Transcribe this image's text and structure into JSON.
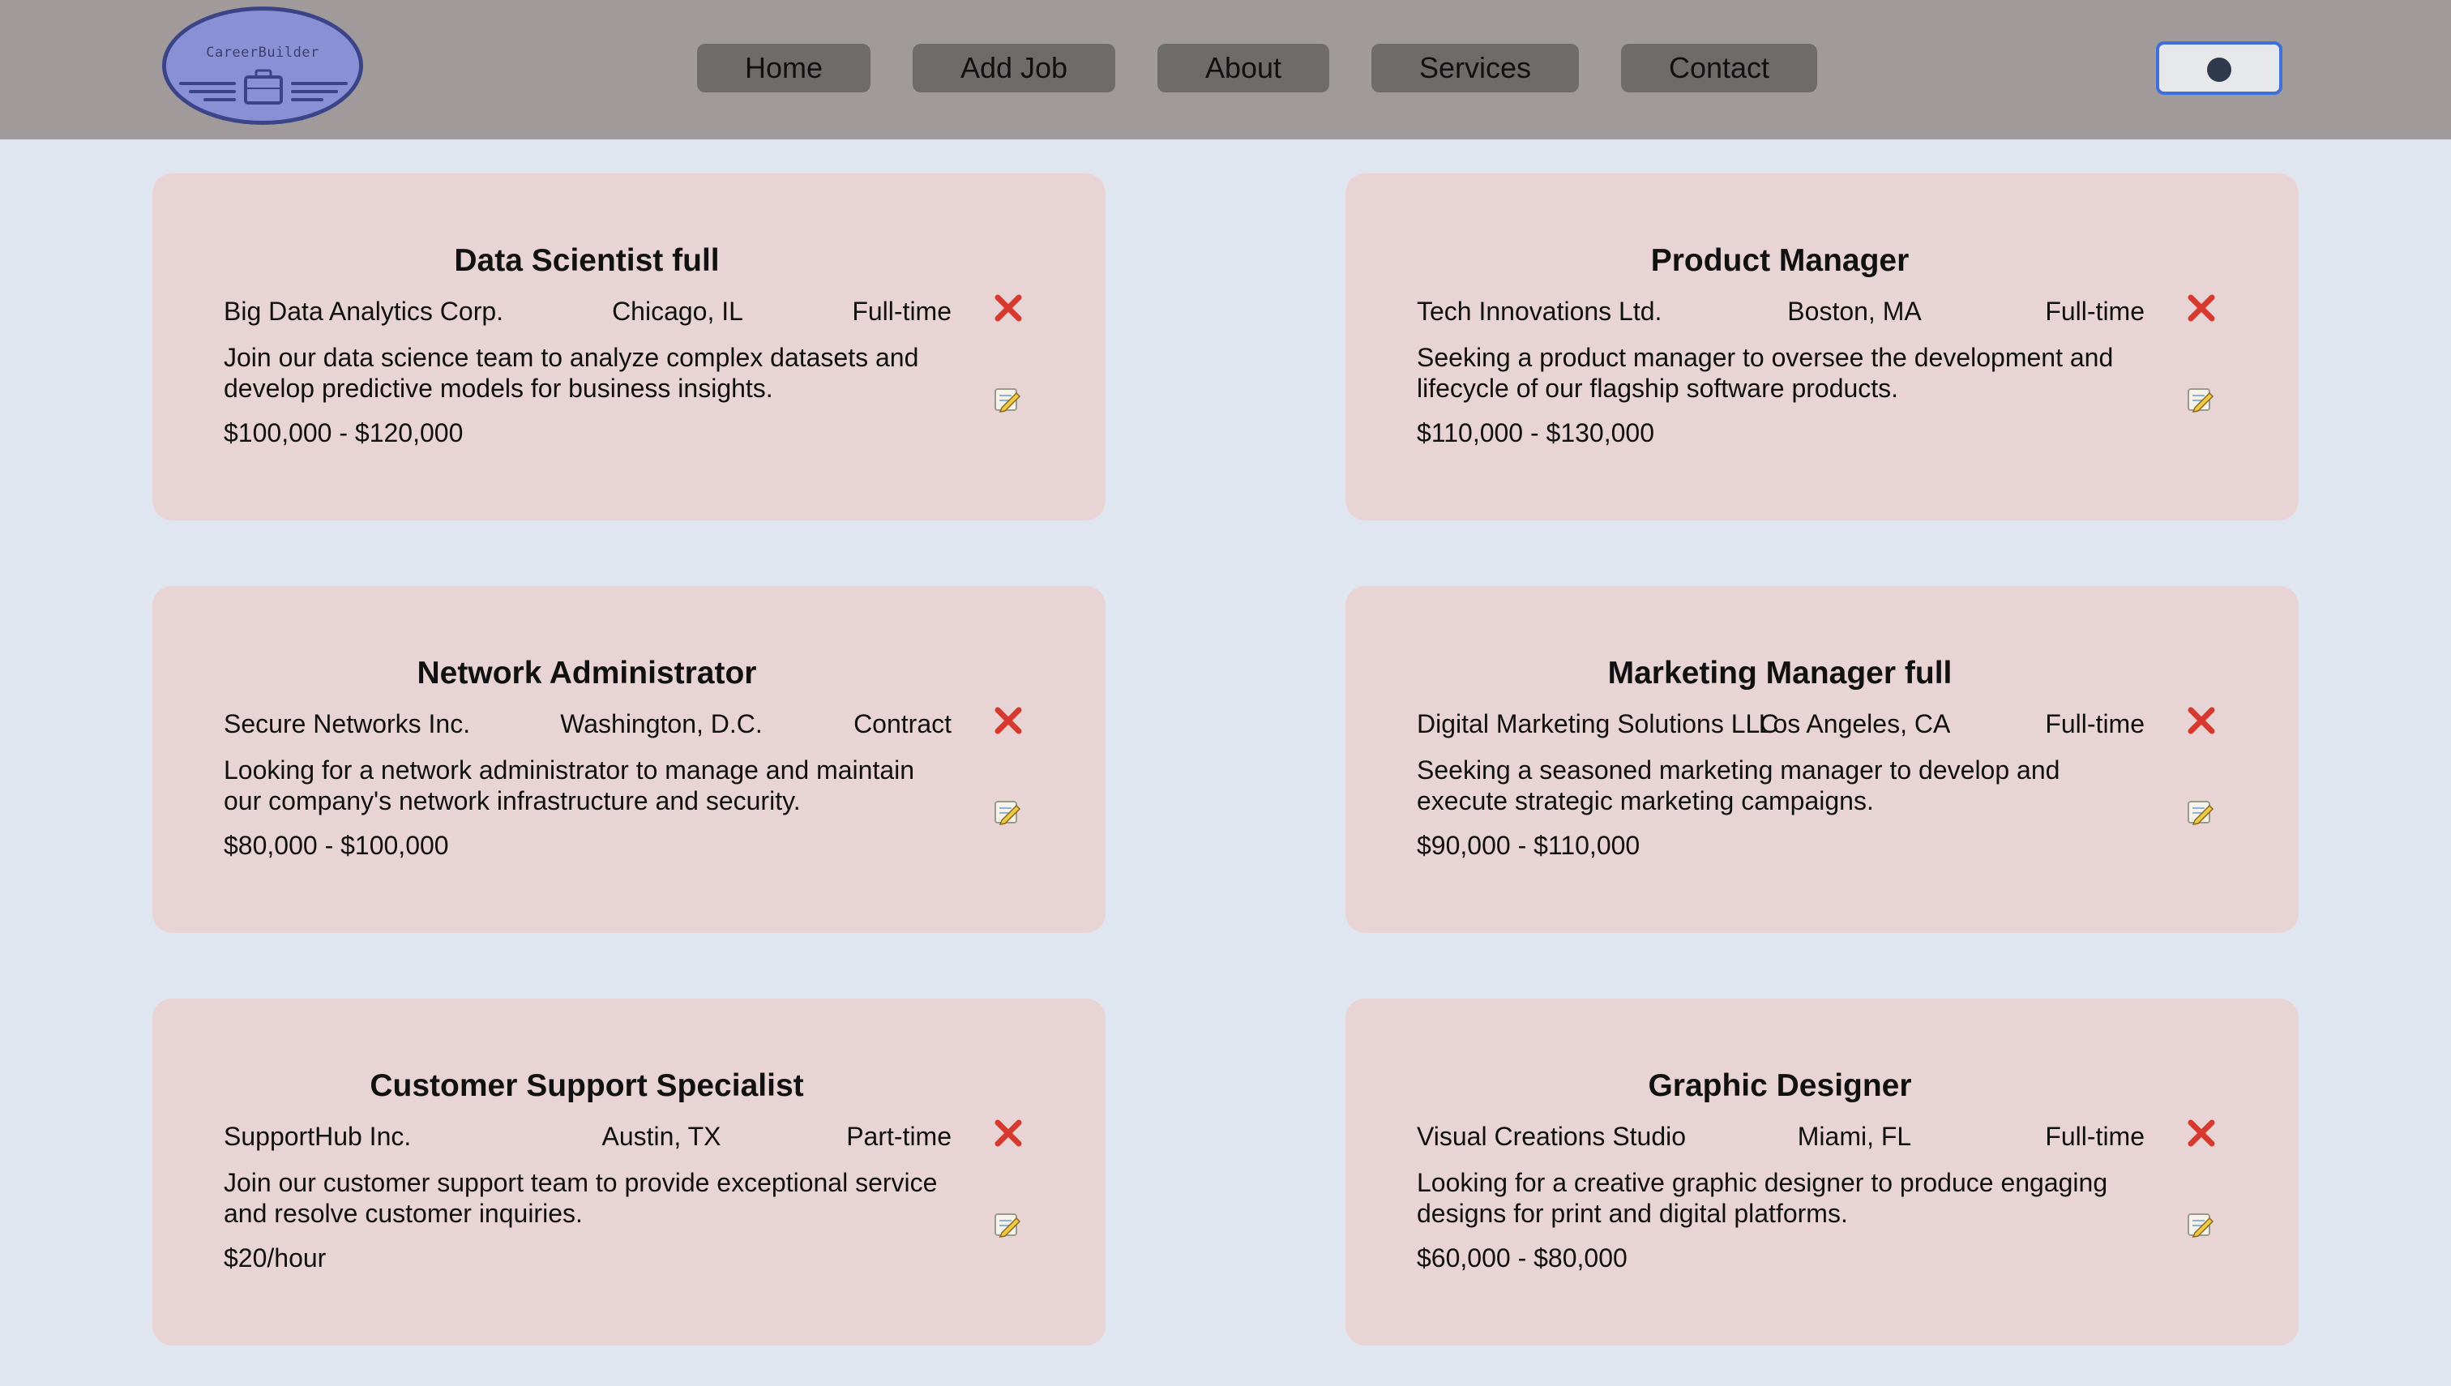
{
  "logo": {
    "text": "CareerBuilder",
    "icon": "briefcase-icon"
  },
  "nav": {
    "links": [
      {
        "label": "Home"
      },
      {
        "label": "Add Job"
      },
      {
        "label": "About"
      },
      {
        "label": "Services"
      },
      {
        "label": "Contact"
      }
    ]
  },
  "theme_toggle": {
    "icon": "theme-toggle-knob"
  },
  "colors": {
    "navbar": "#a09a9a",
    "page_background": "#e0e6f0",
    "card_background": "#e8d4d4",
    "nav_button": "#6e6b6b",
    "delete_icon": "#d63a2f",
    "toggle_border": "#3f6fd9"
  },
  "jobs": [
    {
      "title": "Data Scientist full",
      "company": "Big Data Analytics Corp.",
      "location": "Chicago, IL",
      "type": "Full-time",
      "description": "Join our data science team to analyze complex datasets and develop predictive models for business insights.",
      "salary": "$100,000 - $120,000"
    },
    {
      "title": "Product Manager",
      "company": "Tech Innovations Ltd.",
      "location": "Boston, MA",
      "type": "Full-time",
      "description": "Seeking a product manager to oversee the development and lifecycle of our flagship software products.",
      "salary": "$110,000 - $130,000"
    },
    {
      "title": "Network Administrator",
      "company": "Secure Networks Inc.",
      "location": "Washington, D.C.",
      "type": "Contract",
      "description": "Looking for a network administrator to manage and maintain our company's network infrastructure and security.",
      "salary": "$80,000 - $100,000"
    },
    {
      "title": "Marketing Manager full",
      "company": "Digital Marketing Solutions LLC",
      "location": "Los Angeles, CA",
      "type": "Full-time",
      "description": "Seeking a seasoned marketing manager to develop and execute strategic marketing campaigns.",
      "salary": "$90,000 - $110,000"
    },
    {
      "title": "Customer Support Specialist",
      "company": "SupportHub Inc.",
      "location": "Austin, TX",
      "type": "Part-time",
      "description": "Join our customer support team to provide exceptional service and resolve customer inquiries.",
      "salary": "$20/hour"
    },
    {
      "title": "Graphic Designer",
      "company": "Visual Creations Studio",
      "location": "Miami, FL",
      "type": "Full-time",
      "description": "Looking for a creative graphic designer to produce engaging designs for print and digital platforms.",
      "salary": "$60,000 - $80,000"
    }
  ]
}
